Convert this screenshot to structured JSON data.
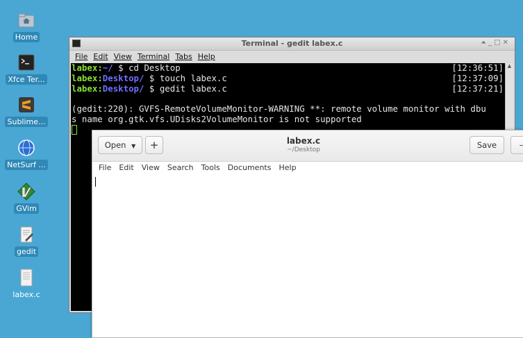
{
  "desktop": {
    "icons": [
      {
        "label": "Home",
        "icon": "home-folder-icon"
      },
      {
        "label": "Xfce Ter...",
        "icon": "terminal-icon"
      },
      {
        "label": "Sublime...",
        "icon": "sublime-text-icon"
      },
      {
        "label": "NetSurf ...",
        "icon": "netsurf-globe-icon"
      },
      {
        "label": "GVim",
        "icon": "gvim-icon"
      },
      {
        "label": "gedit",
        "icon": "gedit-icon"
      },
      {
        "label": "labex.c",
        "icon": "text-file-icon"
      }
    ]
  },
  "terminal": {
    "title": "Terminal - gedit labex.c",
    "menu": [
      "File",
      "Edit",
      "View",
      "Terminal",
      "Tabs",
      "Help"
    ],
    "lines": [
      {
        "user": "labex",
        "path": "~/",
        "cmd": " $ cd Desktop",
        "time": "[12:36:51]"
      },
      {
        "user": "labex",
        "path": "Desktop/",
        "cmd": " $ touch labex.c",
        "time": "[12:37:09]"
      },
      {
        "user": "labex",
        "path": "Desktop/",
        "cmd": " $ gedit labex.c",
        "time": "[12:37:21]"
      }
    ],
    "warning_line1": "(gedit:220): GVFS-RemoteVolumeMonitor-WARNING **: remote volume monitor with dbu",
    "warning_line2": "s name org.gtk.vfs.UDisks2VolumeMonitor is not supported"
  },
  "gedit": {
    "open_label": "Open",
    "new_tab_label": "+",
    "title": "labex.c",
    "subtitle": "~/Desktop",
    "save_label": "Save",
    "menu": [
      "File",
      "Edit",
      "View",
      "Search",
      "Tools",
      "Documents",
      "Help"
    ]
  }
}
